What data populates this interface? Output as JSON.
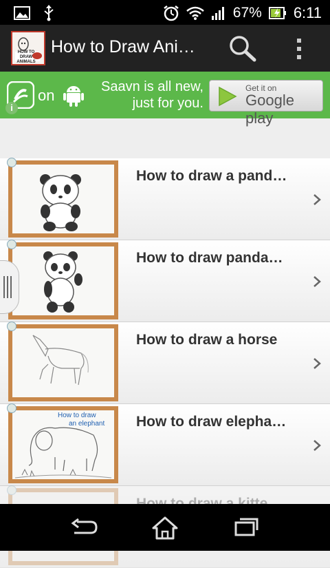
{
  "status_bar": {
    "battery_percent": "67%",
    "time": "6:11",
    "icons": [
      "image-icon",
      "usb-icon",
      "alarm-icon",
      "wifi-icon",
      "signal-icon",
      "battery-icon"
    ]
  },
  "action_bar": {
    "app_icon_text": "HOW TO DRAW ANIMALS",
    "title": "How to Draw Ani…",
    "icons": [
      "search-icon",
      "overflow-menu-icon"
    ]
  },
  "ad": {
    "on_label": "on",
    "text": "Saavn is all new, just for you.",
    "gp_small": "Get it on",
    "gp_big": "Google play",
    "info_label": "i"
  },
  "list": {
    "items": [
      {
        "title": "How to draw a pand…",
        "subject": "panda-sitting"
      },
      {
        "title": "How to draw panda…",
        "subject": "panda-waving"
      },
      {
        "title": "How to draw a horse",
        "subject": "horse"
      },
      {
        "title": "How to draw elepha…",
        "subject": "elephant",
        "thumb_caption_line1": "How to draw",
        "thumb_caption_line2": "an elephant"
      },
      {
        "title": "How to draw a kitte…",
        "subject": "kitten"
      }
    ]
  },
  "nav_bar": {
    "icons": [
      "back-icon",
      "home-icon",
      "recent-apps-icon"
    ]
  },
  "colors": {
    "action_bar": "#222222",
    "ad_green": "#5cb84a",
    "thumb_frame": "#c8884a",
    "title_text": "#333333"
  }
}
